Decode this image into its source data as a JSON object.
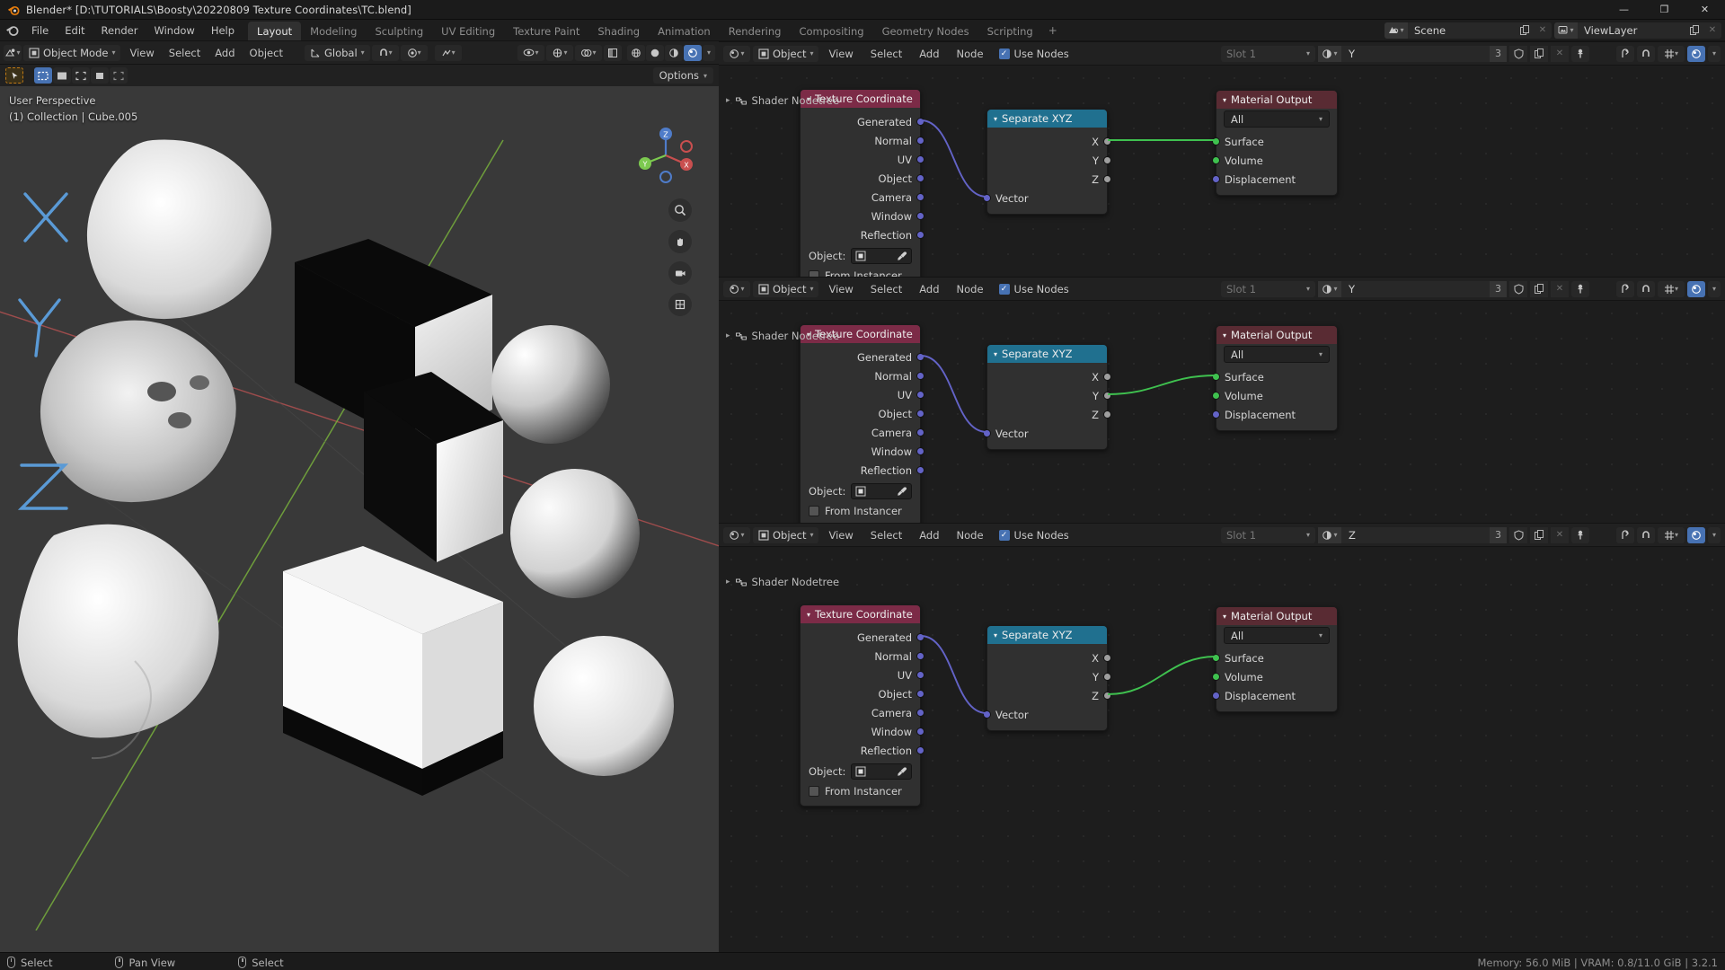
{
  "window": {
    "title": "Blender* [D:\\TUTORIALS\\Boosty\\20220809 Texture Coordinates\\TC.blend]",
    "minimize": "—",
    "maximize": "❐",
    "close": "✕"
  },
  "topbar": {
    "menus": [
      "File",
      "Edit",
      "Render",
      "Window",
      "Help"
    ],
    "workspaces": [
      {
        "label": "Layout",
        "active": true
      },
      {
        "label": "Modeling",
        "active": false
      },
      {
        "label": "Sculpting",
        "active": false
      },
      {
        "label": "UV Editing",
        "active": false
      },
      {
        "label": "Texture Paint",
        "active": false
      },
      {
        "label": "Shading",
        "active": false
      },
      {
        "label": "Animation",
        "active": false
      },
      {
        "label": "Rendering",
        "active": false
      },
      {
        "label": "Compositing",
        "active": false
      },
      {
        "label": "Geometry Nodes",
        "active": false
      },
      {
        "label": "Scripting",
        "active": false
      }
    ],
    "add_workspace": "+",
    "scene": {
      "name": "Scene",
      "new_icon": "copy-icon",
      "remove_icon": "✕"
    },
    "viewlayer": {
      "name": "ViewLayer",
      "new_icon": "copy-icon",
      "remove_icon": "✕"
    }
  },
  "viewport": {
    "editor_type_icon": "editor-type-icon",
    "mode": "Object Mode",
    "menus": [
      "View",
      "Select",
      "Add",
      "Object"
    ],
    "transform_orientation": "Global",
    "options_label": "Options",
    "overlay_line1": "User Perspective",
    "overlay_line2": "(1) Collection | Cube.005",
    "gizmo_axes": [
      "X",
      "Y",
      "Z"
    ],
    "nav_buttons": [
      "zoom-icon",
      "pan-icon",
      "camera-icon",
      "ortho-toggle-icon"
    ],
    "axis_letters": [
      "X",
      "Y",
      "Z"
    ]
  },
  "node_editors": [
    {
      "id": "editor-top",
      "editor_icon": "shader-editor-icon",
      "shader_type": "Object",
      "menus": [
        "View",
        "Select",
        "Add",
        "Node"
      ],
      "use_nodes_label": "Use Nodes",
      "use_nodes_checked": true,
      "slot": "Slot 1",
      "material_name": "Y",
      "material_users": "3",
      "breadcrumb": "Shader Nodetree",
      "nodes": {
        "texture_coordinate": {
          "title": "Texture Coordinate",
          "outputs": [
            "Generated",
            "Normal",
            "UV",
            "Object",
            "Camera",
            "Window",
            "Reflection"
          ],
          "object_label": "Object:",
          "object_value": "",
          "from_instancer_label": "From Instancer"
        },
        "separate_xyz": {
          "title": "Separate XYZ",
          "outputs": [
            "X",
            "Y",
            "Z"
          ],
          "inputs": [
            "Vector"
          ],
          "connected_output": "X"
        },
        "material_output": {
          "title": "Material Output",
          "target": "All",
          "inputs": [
            "Surface",
            "Volume",
            "Displacement"
          ]
        }
      }
    },
    {
      "id": "editor-middle",
      "editor_icon": "shader-editor-icon",
      "shader_type": "Object",
      "menus": [
        "View",
        "Select",
        "Add",
        "Node"
      ],
      "use_nodes_label": "Use Nodes",
      "use_nodes_checked": true,
      "slot": "Slot 1",
      "material_name": "Y",
      "material_users": "3",
      "breadcrumb": "Shader Nodetree",
      "nodes": {
        "texture_coordinate": {
          "title": "Texture Coordinate",
          "outputs": [
            "Generated",
            "Normal",
            "UV",
            "Object",
            "Camera",
            "Window",
            "Reflection"
          ],
          "object_label": "Object:",
          "object_value": "",
          "from_instancer_label": "From Instancer"
        },
        "separate_xyz": {
          "title": "Separate XYZ",
          "outputs": [
            "X",
            "Y",
            "Z"
          ],
          "inputs": [
            "Vector"
          ],
          "connected_output": "Y"
        },
        "material_output": {
          "title": "Material Output",
          "target": "All",
          "inputs": [
            "Surface",
            "Volume",
            "Displacement"
          ]
        }
      }
    },
    {
      "id": "editor-bottom",
      "editor_icon": "shader-editor-icon",
      "shader_type": "Object",
      "menus": [
        "View",
        "Select",
        "Add",
        "Node"
      ],
      "use_nodes_label": "Use Nodes",
      "use_nodes_checked": true,
      "slot": "Slot 1",
      "material_name": "Z",
      "material_users": "3",
      "breadcrumb": "Shader Nodetree",
      "nodes": {
        "texture_coordinate": {
          "title": "Texture Coordinate",
          "outputs": [
            "Generated",
            "Normal",
            "UV",
            "Object",
            "Camera",
            "Window",
            "Reflection"
          ],
          "object_label": "Object:",
          "object_value": "",
          "from_instancer_label": "From Instancer"
        },
        "separate_xyz": {
          "title": "Separate XYZ",
          "outputs": [
            "X",
            "Y",
            "Z"
          ],
          "inputs": [
            "Vector"
          ],
          "connected_output": "Z"
        },
        "material_output": {
          "title": "Material Output",
          "target": "All",
          "inputs": [
            "Surface",
            "Volume",
            "Displacement"
          ]
        }
      }
    }
  ],
  "statusbar": {
    "items": [
      "Select",
      "Pan View",
      "Select"
    ],
    "info": "Memory: 56.0 MiB | VRAM: 0.8/11.0 GiB | 3.2.1"
  },
  "colors": {
    "accent_blue": "#4772b3",
    "node_tex_header": "#7c2b47",
    "node_sep_header": "#20708f",
    "node_out_header": "#592b33",
    "socket_vector": "#6363c7",
    "socket_value": "#9e9e9e",
    "socket_shader": "#3fc14f",
    "link_vector": "#6363c7",
    "link_shader": "#3fc14f",
    "axis_x": "#c94f4f",
    "axis_y": "#7cc94f",
    "axis_z": "#4f7cc9"
  }
}
